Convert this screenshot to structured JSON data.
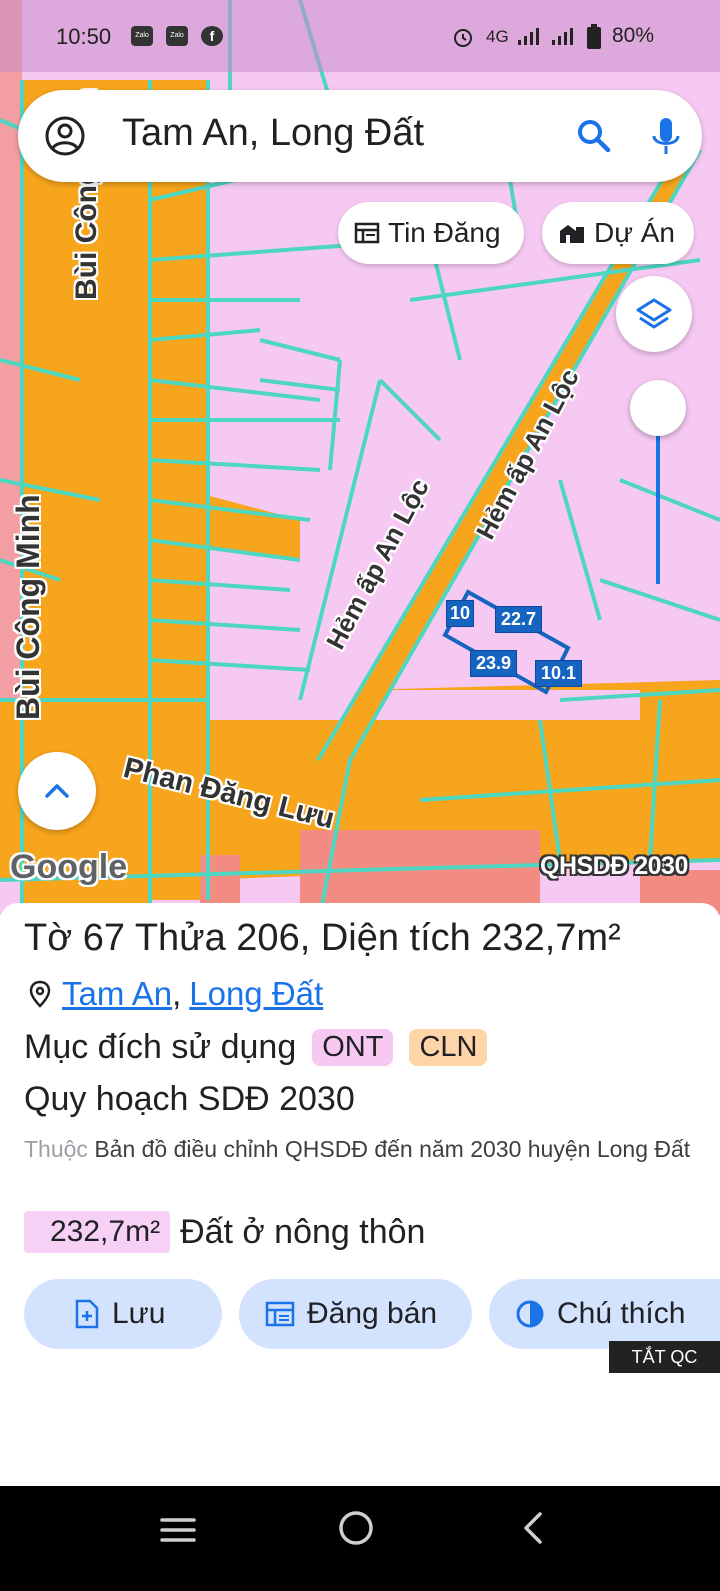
{
  "status_bar": {
    "time": "10:50",
    "apps": [
      "Zalo",
      "Zalo",
      "f"
    ],
    "network": "4G",
    "battery": "80%"
  },
  "search": {
    "query": "Tam An, Long Đất",
    "icons": [
      "account-circle-icon",
      "search-icon",
      "mic-icon"
    ]
  },
  "chips": {
    "listings": "Tin Đăng",
    "projects": "Dự Án"
  },
  "map": {
    "streets": {
      "bui_cong_minh": "Bùi Công Minh",
      "bui_cong_minh_top": "Bùi Công Minh",
      "hem_an_loc_1": "Hẻm ấp An Lộc",
      "hem_an_loc_2": "Hẻm ấp An Lộc",
      "phan_dang_luu": "Phan Đăng Lưu"
    },
    "dimensions": [
      "22.7",
      "23.9",
      "10.1",
      "10"
    ],
    "attribution": "Google",
    "layer_name": "QHSDĐ 2030",
    "zoom_level": 0.9,
    "colors": {
      "residential": "#f6c9f2",
      "road": "#f7a51c",
      "parcel_border": "#4dd6c0",
      "selected_parcel": "#1565c0"
    }
  },
  "sheet": {
    "title": "Tờ 67 Thửa 206, Diện tích 232,7m²",
    "location_ward": "Tam An",
    "location_comma": ",",
    "location_district": "Long Đất",
    "purpose_label": "Mục đích sử dụng",
    "purpose_badges": [
      "ONT",
      "CLN"
    ],
    "plan_title": "Quy hoạch SDĐ 2030",
    "plan_desc_prefix": "Thuộc",
    "plan_desc": "Bản đồ điều chỉnh QHSDĐ đến năm 2030 huyện Long Đất",
    "area_value": "232,7m²",
    "area_type": "Đất ở nông thôn",
    "actions": {
      "save": "Lưu",
      "post": "Đăng bán",
      "legend": "Chú thích"
    },
    "ad_close": "TẮT QC"
  },
  "nav": {
    "icons": [
      "menu-icon",
      "home-icon",
      "back-icon"
    ]
  }
}
